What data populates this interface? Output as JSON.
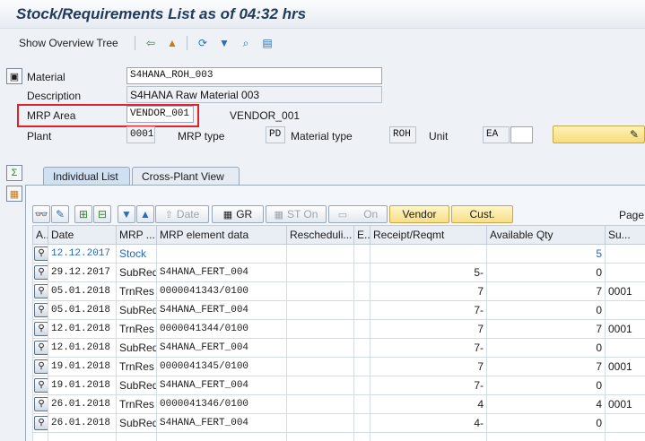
{
  "window": {
    "title": "Stock/Requirements List as of 04:32 hrs"
  },
  "toolbar": {
    "show_overview_tree": "Show Overview Tree",
    "icons": [
      "back-icon",
      "mountain-icon",
      "refresh-icon",
      "filter-icon",
      "find-icon",
      "settings-icon"
    ]
  },
  "header": {
    "material_label": "Material",
    "material_value": "S4HANA_ROH_003",
    "description_label": "Description",
    "description_value": "S4HANA Raw Material 003",
    "mrp_area_label": "MRP Area",
    "mrp_area_value": "VENDOR_001",
    "mrp_area_text": "VENDOR_001",
    "plant_label": "Plant",
    "plant_value": "0001",
    "mrp_type_label": "MRP type",
    "mrp_type_value": "PD",
    "material_type_label": "Material type",
    "material_type_value": "ROH",
    "unit_label": "Unit",
    "unit_value": "EA"
  },
  "tabs": {
    "individual_list": "Individual List",
    "cross_plant_view": "Cross-Plant View"
  },
  "grid_toolbar": {
    "date": "Date",
    "gr": "GR",
    "st_on": "ST On",
    "on": "On",
    "vendor": "Vendor",
    "cust": "Cust.",
    "page": "Page"
  },
  "columns": [
    "A..",
    "Date",
    "MRP ...",
    "MRP element data",
    "Rescheduli...",
    "E..",
    "Receipt/Reqmt",
    "Available Qty",
    "Su..."
  ],
  "rows": [
    {
      "date": "12.12.2017",
      "mrp": "Stock",
      "element": "",
      "resched": "",
      "e": "",
      "receipt": "",
      "avail": "5",
      "su": ""
    },
    {
      "date": "29.12.2017",
      "mrp": "SubReq",
      "element": "S4HANA_FERT_004",
      "resched": "",
      "e": "",
      "receipt": "5-",
      "avail": "0",
      "su": ""
    },
    {
      "date": "05.01.2018",
      "mrp": "TrnRes",
      "element": "0000041343/0100",
      "resched": "",
      "e": "",
      "receipt": "7",
      "avail": "7",
      "su": "0001"
    },
    {
      "date": "05.01.2018",
      "mrp": "SubReq",
      "element": "S4HANA_FERT_004",
      "resched": "",
      "e": "",
      "receipt": "7-",
      "avail": "0",
      "su": ""
    },
    {
      "date": "12.01.2018",
      "mrp": "TrnRes",
      "element": "0000041344/0100",
      "resched": "",
      "e": "",
      "receipt": "7",
      "avail": "7",
      "su": "0001"
    },
    {
      "date": "12.01.2018",
      "mrp": "SubReq",
      "element": "S4HANA_FERT_004",
      "resched": "",
      "e": "",
      "receipt": "7-",
      "avail": "0",
      "su": ""
    },
    {
      "date": "19.01.2018",
      "mrp": "TrnRes",
      "element": "0000041345/0100",
      "resched": "",
      "e": "",
      "receipt": "7",
      "avail": "7",
      "su": "0001"
    },
    {
      "date": "19.01.2018",
      "mrp": "SubReq",
      "element": "S4HANA_FERT_004",
      "resched": "",
      "e": "",
      "receipt": "7-",
      "avail": "0",
      "su": ""
    },
    {
      "date": "26.01.2018",
      "mrp": "TrnRes",
      "element": "0000041346/0100",
      "resched": "",
      "e": "",
      "receipt": "4",
      "avail": "4",
      "su": "0001"
    },
    {
      "date": "26.01.2018",
      "mrp": "SubReq",
      "element": "S4HANA_FERT_004",
      "resched": "",
      "e": "",
      "receipt": "4-",
      "avail": "0",
      "su": ""
    }
  ],
  "colors": {
    "highlight": "#e0232a",
    "stock_text": "#2566b5",
    "accent_yellow": "#f6dc79"
  }
}
